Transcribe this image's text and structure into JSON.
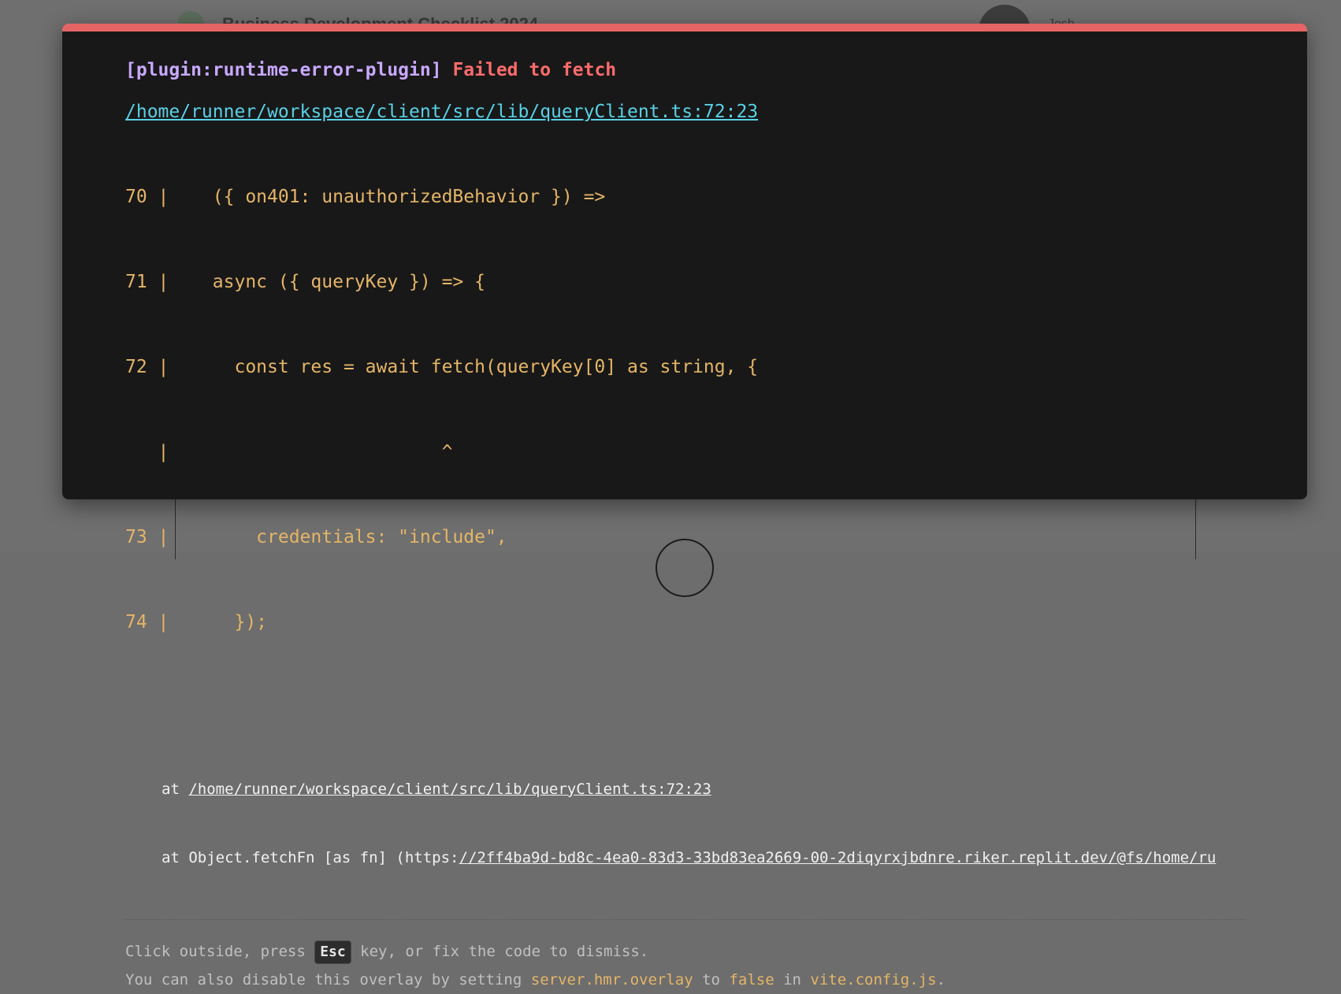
{
  "background": {
    "title": "Business Development Checklist 2024",
    "user_name": "Josh"
  },
  "overlay": {
    "plugin_label": "[plugin:runtime-error-plugin]",
    "message": "Failed to fetch",
    "file_link": "/home/runner/workspace/client/src/lib/queryClient.ts:72:23",
    "code_frame": [
      "70 |    ({ on401: unauthorizedBehavior }) =>",
      "71 |    async ({ queryKey }) => {",
      "72 |      const res = await fetch(queryKey[0] as string, {",
      "   |                         ^",
      "73 |        credentials: \"include\",",
      "74 |      });"
    ],
    "stack": {
      "line1_prefix": "at ",
      "line1_link": "/home/runner/workspace/client/src/lib/queryClient.ts:72:23",
      "line2_prefix": "at Object.fetchFn [as fn] (https:",
      "line2_link": "//2ff4ba9d-bd8c-4ea0-83d3-33bd83ea2669-00-2diqyrxjbdnre.riker.replit.dev/@fs/home/ru"
    },
    "tip": {
      "line1_before": "Click outside, press ",
      "key": "Esc",
      "line1_after": " key, or fix the code to dismiss.",
      "line2_before": "You can also disable this overlay by setting ",
      "line2_code1": "server.hmr.overlay",
      "line2_mid1": " to ",
      "line2_code2": "false",
      "line2_mid2": " in ",
      "line2_code3": "vite.config.js",
      "line2_end": "."
    }
  },
  "colors": {
    "accent_bar": "#e56565",
    "plugin": "#c9a8ff",
    "message": "#ff6b6b",
    "link": "#59d1e6",
    "code": "#e5b567"
  }
}
